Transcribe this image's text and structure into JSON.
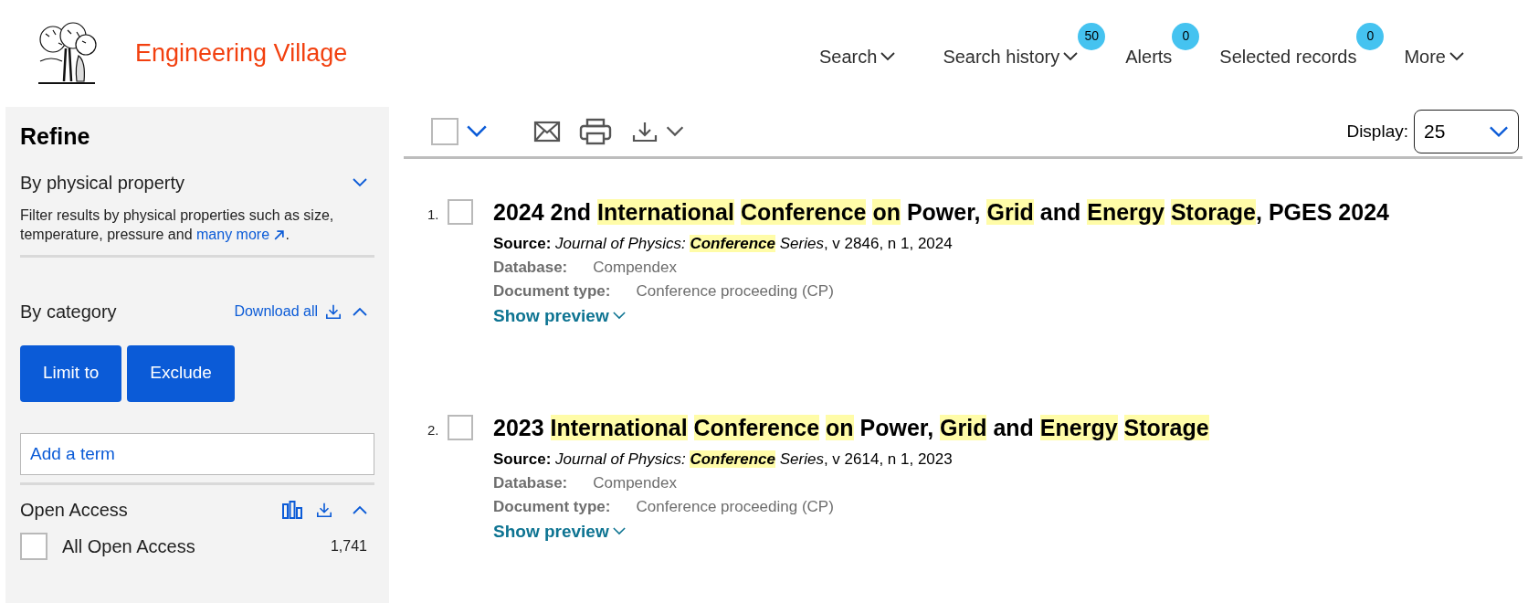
{
  "header": {
    "logo_text": "Engineering Village",
    "nav": [
      {
        "label": "Search",
        "dropdown": true
      },
      {
        "label": "Search history",
        "dropdown": true,
        "badge": "50"
      },
      {
        "label": "Alerts",
        "dropdown": false,
        "badge": "0"
      },
      {
        "label": "Selected records",
        "dropdown": false,
        "badge": "0"
      },
      {
        "label": "More",
        "dropdown": true
      }
    ]
  },
  "sidebar": {
    "title": "Refine",
    "physical_property": {
      "title": "By physical property",
      "expanded": false,
      "description": "Filter results by physical properties such as size, temperature, pressure and",
      "link": "many more",
      "description_end": "."
    },
    "category": {
      "title": "By category",
      "download_link": "Download all",
      "expanded": true,
      "buttons": [
        "Limit to",
        "Exclude"
      ],
      "term_placeholder": "Add a term"
    },
    "open_access": {
      "title": "Open Access",
      "expanded": true,
      "options": [
        {
          "label": "All Open Access",
          "count": "1,741",
          "checked": false
        }
      ]
    }
  },
  "toolbar": {
    "select_all_checked": false,
    "display_label": "Display:",
    "display_value": "25"
  },
  "results": [
    {
      "number": "1.",
      "checked": false,
      "title": [
        {
          "text": "2024 2nd ",
          "highlight": false
        },
        {
          "text": "International ",
          "highlight": true
        },
        {
          "text": "Conference ",
          "highlight": true
        },
        {
          "text": "on",
          "highlight": true
        },
        {
          "text": " Power, ",
          "highlight": false
        },
        {
          "text": "Grid",
          "highlight": true
        },
        {
          "text": " and ",
          "highlight": false
        },
        {
          "text": "Energy ",
          "highlight": true
        },
        {
          "text": "Storage",
          "highlight": true
        },
        {
          "text": ", PGES 2024",
          "highlight": false
        }
      ],
      "source_label": "Source:",
      "source": [
        {
          "text": "Journal of Physics: ",
          "highlight": false
        },
        {
          "text": "Conference",
          "highlight": true
        },
        {
          "text": " Series",
          "highlight": false
        }
      ],
      "source_rest": ", v 2846, n 1, 2024",
      "fields": [
        {
          "label": "Database:",
          "value": "Compendex"
        },
        {
          "label": "Document type:",
          "value": "Conference proceeding (CP)"
        }
      ],
      "preview_link": "Show preview"
    },
    {
      "number": "2.",
      "checked": false,
      "title": [
        {
          "text": "2023 ",
          "highlight": false
        },
        {
          "text": "International ",
          "highlight": true
        },
        {
          "text": "Conference ",
          "highlight": true
        },
        {
          "text": "on",
          "highlight": true
        },
        {
          "text": " Power, ",
          "highlight": false
        },
        {
          "text": "Grid",
          "highlight": true
        },
        {
          "text": " and ",
          "highlight": false
        },
        {
          "text": "Energy ",
          "highlight": true
        },
        {
          "text": "Storage",
          "highlight": true
        }
      ],
      "source_label": "Source:",
      "source": [
        {
          "text": "Journal of Physics: ",
          "highlight": false
        },
        {
          "text": "Conference",
          "highlight": true
        },
        {
          "text": " Series",
          "highlight": false
        }
      ],
      "source_rest": ", v 2614, n 1, 2023",
      "fields": [
        {
          "label": "Database:",
          "value": "Compendex"
        },
        {
          "label": "Document type:",
          "value": "Conference proceeding (CP)"
        }
      ],
      "preview_link": "Show preview"
    }
  ]
}
